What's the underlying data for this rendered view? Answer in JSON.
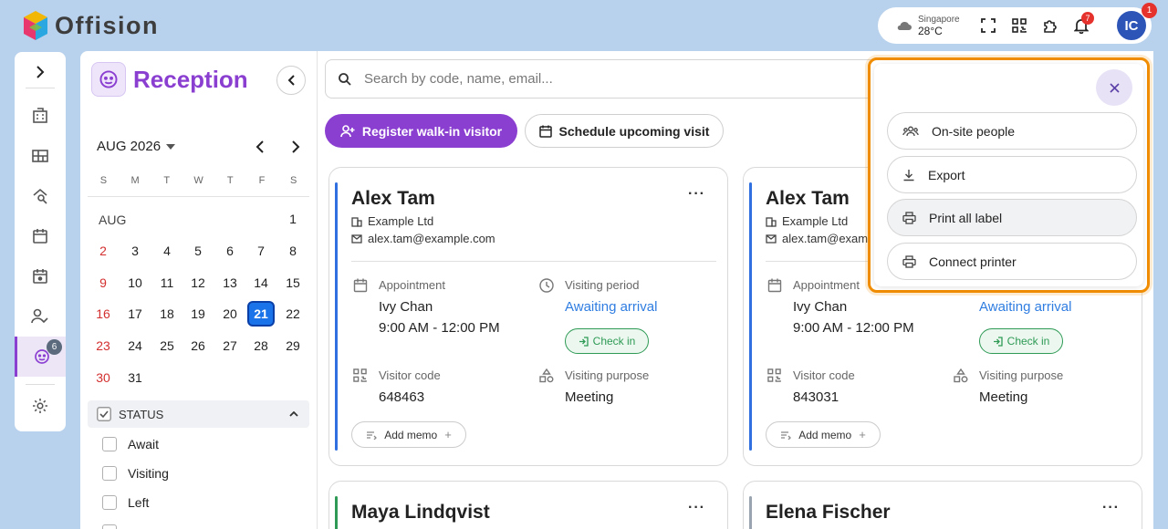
{
  "app": {
    "name": "Offision"
  },
  "topbar": {
    "weather_city": "Singapore",
    "weather_temp": "28°C",
    "notifications_count": "7",
    "avatar_initials": "IC",
    "avatar_badge": "1"
  },
  "rail": {
    "reception_badge": "6"
  },
  "sidebar": {
    "title": "Reception",
    "calendar": {
      "month_label": "AUG 2026",
      "weekdays": [
        "S",
        "M",
        "T",
        "W",
        "T",
        "F",
        "S"
      ],
      "month_short": "AUG",
      "days": [
        "1",
        "2",
        "3",
        "4",
        "5",
        "6",
        "7",
        "8",
        "9",
        "10",
        "11",
        "12",
        "13",
        "14",
        "15",
        "16",
        "17",
        "18",
        "19",
        "20",
        "21",
        "22",
        "23",
        "24",
        "25",
        "26",
        "27",
        "28",
        "29",
        "30",
        "31"
      ],
      "selected_day": "21"
    },
    "status": {
      "header": "STATUS",
      "options": [
        "Await",
        "Visiting",
        "Left"
      ]
    }
  },
  "search": {
    "placeholder": "Search by code, name, email..."
  },
  "actions": {
    "register": "Register walk-in visitor",
    "schedule": "Schedule upcoming visit"
  },
  "labels": {
    "appointment": "Appointment",
    "visiting_period": "Visiting period",
    "visitor_code": "Visitor code",
    "visiting_purpose": "Visiting purpose",
    "check_in": "Check in",
    "add_memo": "Add memo",
    "more": "···"
  },
  "cards": [
    {
      "name": "Alex Tam",
      "company": "Example Ltd",
      "email": "alex.tam@example.com",
      "host": "Ivy Chan",
      "time": "9:00 AM - 12:00 PM",
      "status": "Awaiting arrival",
      "code": "648463",
      "purpose": "Meeting",
      "accent": "#2f6fdf"
    },
    {
      "name": "Alex Tam",
      "company": "Example Ltd",
      "email": "alex.tam@exam",
      "host": "Ivy Chan",
      "time": "9:00 AM - 12:00 PM",
      "status": "Awaiting arrival",
      "code": "843031",
      "purpose": "Meeting",
      "accent": "#2f6fdf"
    },
    {
      "name": "Maya Lindqvist",
      "accent": "#2e9a55"
    },
    {
      "name": "Elena Fischer",
      "accent": "#9aa4b0"
    }
  ],
  "menu": {
    "items": [
      "On-site people",
      "Export",
      "Print all label",
      "Connect printer"
    ]
  },
  "colors": {
    "brand": "#8b3fd1",
    "primary_blue": "#1a73e8",
    "highlight": "#f08c00",
    "success": "#2e9a55"
  }
}
